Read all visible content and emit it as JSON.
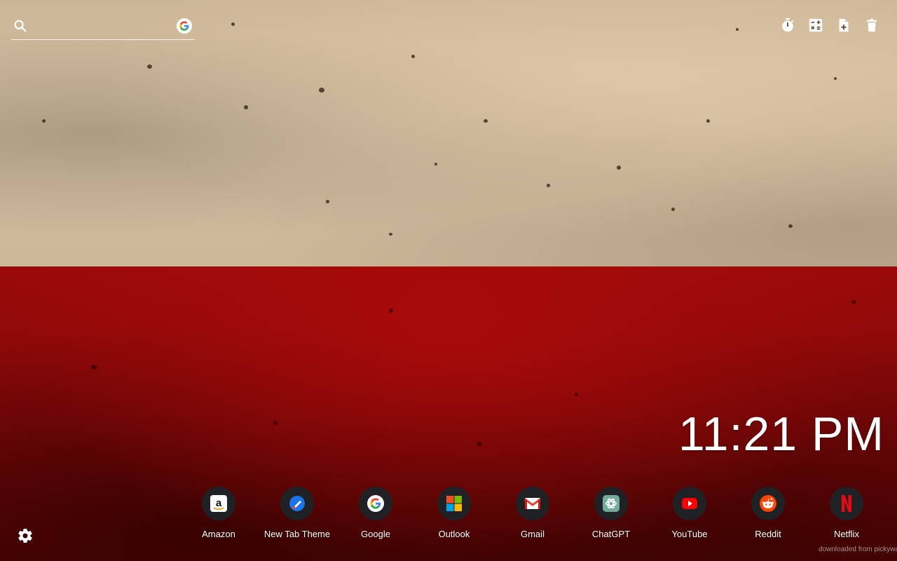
{
  "search": {
    "value": "",
    "placeholder": "",
    "search_icon": "search-icon",
    "engine_icon": "google-icon"
  },
  "toolbar": {
    "tools": [
      {
        "name": "timer",
        "icon": "stopwatch-icon"
      },
      {
        "name": "calculator",
        "icon": "calculator-icon"
      },
      {
        "name": "new-note",
        "icon": "note-add-icon"
      },
      {
        "name": "trash",
        "icon": "trash-icon"
      }
    ]
  },
  "clock": {
    "time": "11:21 PM"
  },
  "dock": {
    "items": [
      {
        "label": "Amazon",
        "icon": "amazon-icon"
      },
      {
        "label": "New Tab Theme",
        "icon": "brush-icon"
      },
      {
        "label": "Google",
        "icon": "google-icon"
      },
      {
        "label": "Outlook",
        "icon": "microsoft-icon"
      },
      {
        "label": "Gmail",
        "icon": "gmail-icon"
      },
      {
        "label": "ChatGPT",
        "icon": "chatgpt-icon"
      },
      {
        "label": "YouTube",
        "icon": "youtube-icon"
      },
      {
        "label": "Reddit",
        "icon": "reddit-icon"
      },
      {
        "label": "Netflix",
        "icon": "netflix-icon"
      }
    ]
  },
  "settings": {
    "icon": "gear-icon"
  },
  "footer": {
    "credit": "downloaded from pickywallpapers.com"
  },
  "colors": {
    "flag_white": "#d3bd9f",
    "flag_red": "#8a0909",
    "dock_circle": "#202124"
  }
}
